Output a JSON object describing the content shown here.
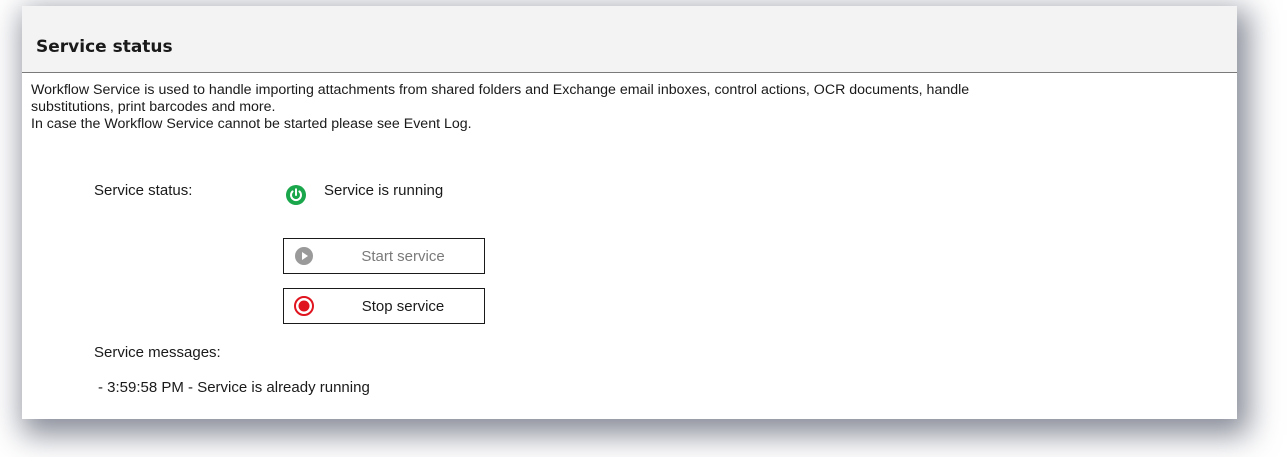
{
  "header": {
    "title": "Service status"
  },
  "description": {
    "text": "Workflow Service is used to handle importing attachments from shared folders and Exchange email inboxes, control actions, OCR documents, handle\nsubstitutions, print barcodes and more.\nIn case the Workflow Service cannot be started please see Event Log."
  },
  "status": {
    "label": "Service status:",
    "value": "Service is running",
    "icon": "power-icon",
    "color": "#1aa64a"
  },
  "buttons": {
    "start_label": "Start service",
    "stop_label": "Stop service",
    "start_enabled": false,
    "stop_color": "#e0141e"
  },
  "messages": {
    "label": "Service messages:",
    "items": [
      " - 3:59:58 PM - Service is already running"
    ]
  }
}
